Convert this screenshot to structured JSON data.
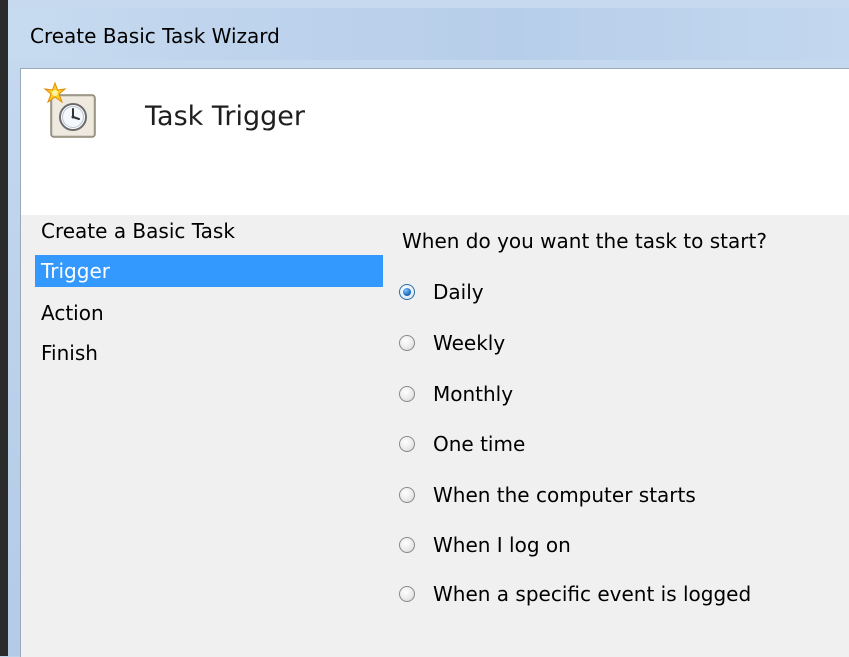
{
  "window": {
    "title": "Create Basic Task Wizard"
  },
  "header": {
    "title": "Task Trigger",
    "icon": "task-clock-icon"
  },
  "nav": {
    "items": [
      {
        "label": "Create a Basic Task",
        "selected": false
      },
      {
        "label": "Trigger",
        "selected": true
      },
      {
        "label": "Action",
        "selected": false
      },
      {
        "label": "Finish",
        "selected": false
      }
    ]
  },
  "trigger": {
    "question": "When do you want the task to start?",
    "selected_value": "Daily",
    "options": [
      {
        "label": "Daily"
      },
      {
        "label": "Weekly"
      },
      {
        "label": "Monthly"
      },
      {
        "label": "One time"
      },
      {
        "label": "When the computer starts"
      },
      {
        "label": "When I log on"
      },
      {
        "label": "When a specific event is logged"
      }
    ]
  },
  "colors": {
    "selection": "#3399ff",
    "titlebar": "#bcd3ea",
    "client_bg": "#f0f0f0",
    "header_bg": "#ffffff"
  }
}
